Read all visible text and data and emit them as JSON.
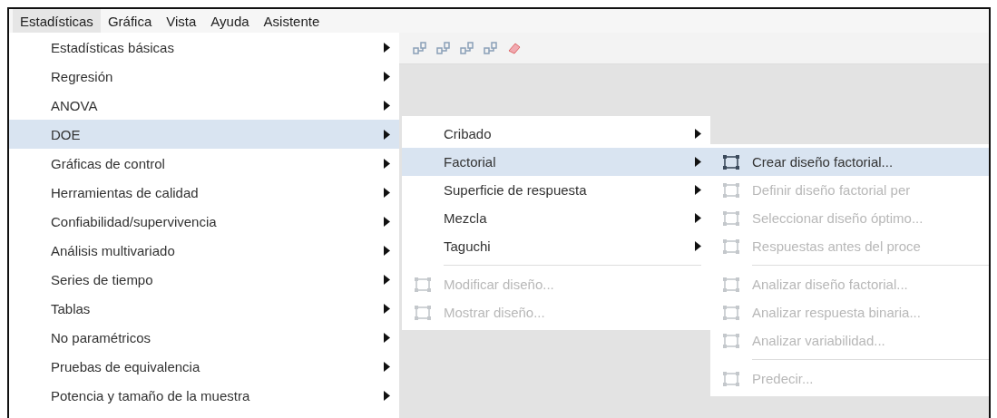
{
  "menubar": [
    {
      "label": "Estadísticas",
      "selected": true
    },
    {
      "label": "Gráfica",
      "selected": false
    },
    {
      "label": "Vista",
      "selected": false
    },
    {
      "label": "Ayuda",
      "selected": false
    },
    {
      "label": "Asistente",
      "selected": false
    }
  ],
  "menu": [
    {
      "kind": "submenu",
      "label": "Estadísticas básicas",
      "selected": false
    },
    {
      "kind": "submenu",
      "label": "Regresión",
      "selected": false
    },
    {
      "kind": "submenu",
      "label": "ANOVA",
      "selected": false
    },
    {
      "kind": "submenu",
      "label": "DOE",
      "selected": true
    },
    {
      "kind": "submenu",
      "label": "Gráficas de control",
      "selected": false
    },
    {
      "kind": "submenu",
      "label": "Herramientas de calidad",
      "selected": false
    },
    {
      "kind": "submenu",
      "label": "Confiabilidad/supervivencia",
      "selected": false
    },
    {
      "kind": "submenu",
      "label": "Análisis multivariado",
      "selected": false
    },
    {
      "kind": "submenu",
      "label": "Series de tiempo",
      "selected": false
    },
    {
      "kind": "submenu",
      "label": "Tablas",
      "selected": false
    },
    {
      "kind": "submenu",
      "label": "No paramétricos",
      "selected": false
    },
    {
      "kind": "submenu",
      "label": "Pruebas de equivalencia",
      "selected": false
    },
    {
      "kind": "submenu",
      "label": "Potencia y tamaño de la muestra",
      "selected": false
    }
  ],
  "doe_menu": [
    {
      "kind": "submenu",
      "label": "Cribado",
      "selected": false,
      "disabled": false
    },
    {
      "kind": "submenu",
      "label": "Factorial",
      "selected": true,
      "disabled": false
    },
    {
      "kind": "submenu",
      "label": "Superficie de respuesta",
      "selected": false,
      "disabled": false
    },
    {
      "kind": "submenu",
      "label": "Mezcla",
      "selected": false,
      "disabled": false
    },
    {
      "kind": "submenu",
      "label": "Taguchi",
      "selected": false,
      "disabled": false
    },
    {
      "kind": "separator"
    },
    {
      "kind": "command",
      "label": "Modificar diseño...",
      "selected": false,
      "disabled": true
    },
    {
      "kind": "command",
      "label": "Mostrar diseño...",
      "selected": false,
      "disabled": true
    }
  ],
  "factorial_menu": [
    {
      "kind": "command",
      "label": "Crear diseño factorial...",
      "selected": true,
      "disabled": false
    },
    {
      "kind": "command",
      "label": "Definir diseño factorial per",
      "selected": false,
      "disabled": true
    },
    {
      "kind": "command",
      "label": "Seleccionar diseño óptimo...",
      "selected": false,
      "disabled": true
    },
    {
      "kind": "command",
      "label": "Respuestas antes del proce",
      "selected": false,
      "disabled": true
    },
    {
      "kind": "separator"
    },
    {
      "kind": "command",
      "label": "Analizar diseño factorial...",
      "selected": false,
      "disabled": true
    },
    {
      "kind": "command",
      "label": "Analizar respuesta binaria...",
      "selected": false,
      "disabled": true
    },
    {
      "kind": "command",
      "label": "Analizar variabilidad...",
      "selected": false,
      "disabled": true
    },
    {
      "kind": "separator"
    },
    {
      "kind": "command",
      "label": "Predecir...",
      "selected": false,
      "disabled": true
    }
  ]
}
